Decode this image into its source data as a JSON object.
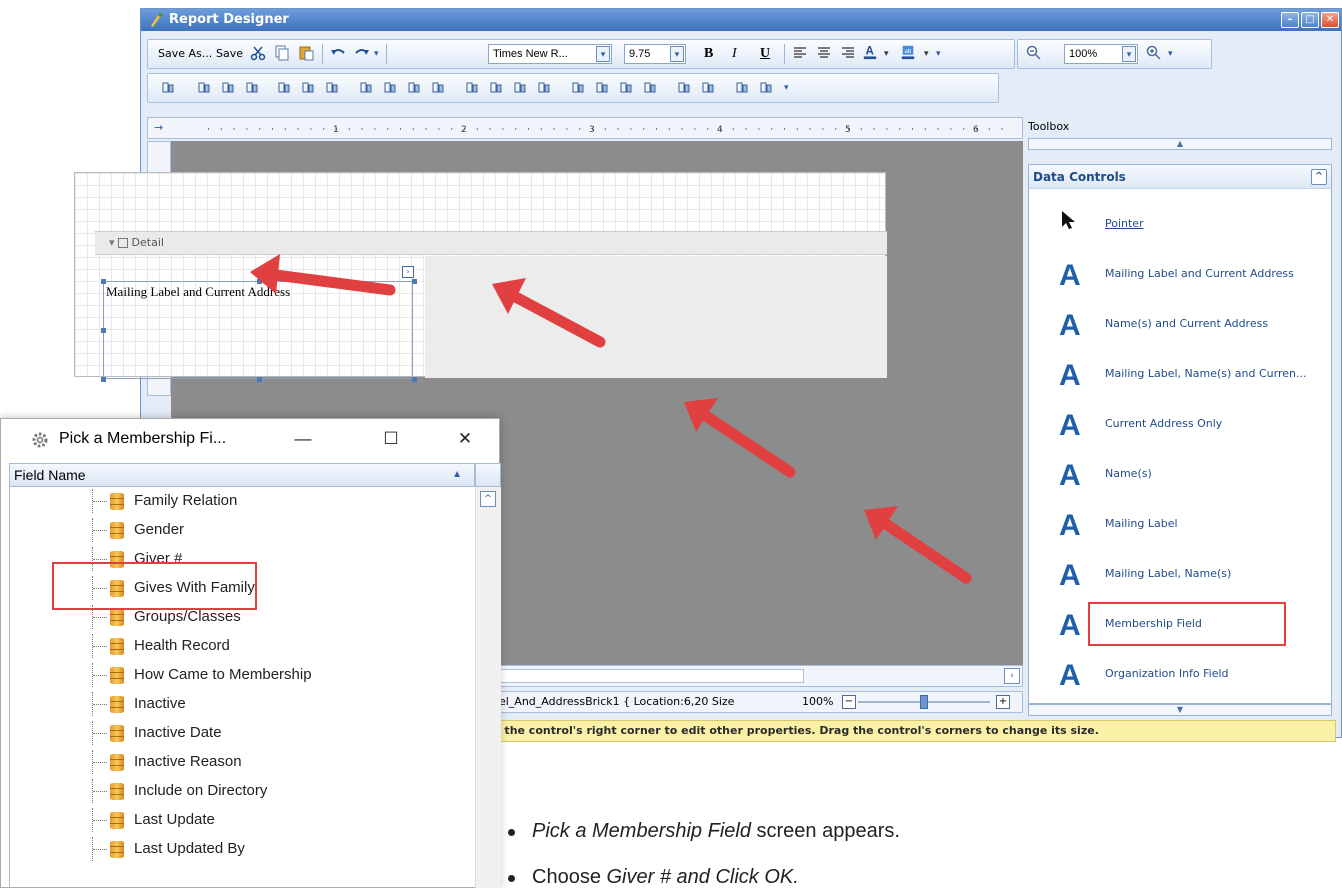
{
  "window": {
    "title": "Report Designer"
  },
  "toolbar1": {
    "save_as": "Save As...",
    "save": "Save",
    "font": "Times New R...",
    "size": "9.75",
    "bold": "B",
    "italic": "I",
    "underline": "U",
    "zoom": "100%"
  },
  "designer": {
    "band_label": "Detail",
    "control_text": "Mailing Label and Current Address",
    "status_text": "bel_And_AddressBrick1 { Location:6,20 Size",
    "status_zoom": "100%",
    "hint": "in the control's right corner to edit other properties. Drag the control's corners to change its size."
  },
  "toolbox": {
    "title": "Toolbox",
    "category": "Data Controls",
    "items": [
      {
        "label": "Pointer",
        "icon": "pointer-icon"
      },
      {
        "label": "Mailing Label and Current Address",
        "icon": "text-A-icon"
      },
      {
        "label": "Name(s) and Current Address",
        "icon": "text-A-icon"
      },
      {
        "label": "Mailing Label, Name(s) and Curren...",
        "icon": "text-A-icon"
      },
      {
        "label": "Current Address Only",
        "icon": "text-A-icon"
      },
      {
        "label": "Name(s)",
        "icon": "text-A-icon"
      },
      {
        "label": "Mailing Label",
        "icon": "text-A-icon"
      },
      {
        "label": "Mailing Label, Name(s)",
        "icon": "text-A-icon"
      },
      {
        "label": "Membership Field",
        "icon": "text-A-icon"
      },
      {
        "label": "Organization Info Field",
        "icon": "text-A-icon"
      }
    ]
  },
  "dialog": {
    "title": "Pick a Membership Fi...",
    "column_header": "Field Name",
    "fields": [
      "Family Relation",
      "Gender",
      "Giver #",
      "Gives With Family",
      "Groups/Classes",
      "Health Record",
      "How Came to Membership",
      "Inactive",
      "Inactive Date",
      "Inactive Reason",
      "Include on Directory",
      "Last Update",
      "Last Updated By"
    ]
  },
  "instructions": {
    "line1_italic": "Pick a Membership Field",
    "line1_rest": " screen appears.",
    "line2_plain": "Choose ",
    "line2_italic": "Giver # and Click OK."
  },
  "colors": {
    "highlight": "#e04040",
    "accent": "#1f5fa9",
    "hint_bg": "#faf0a6"
  }
}
